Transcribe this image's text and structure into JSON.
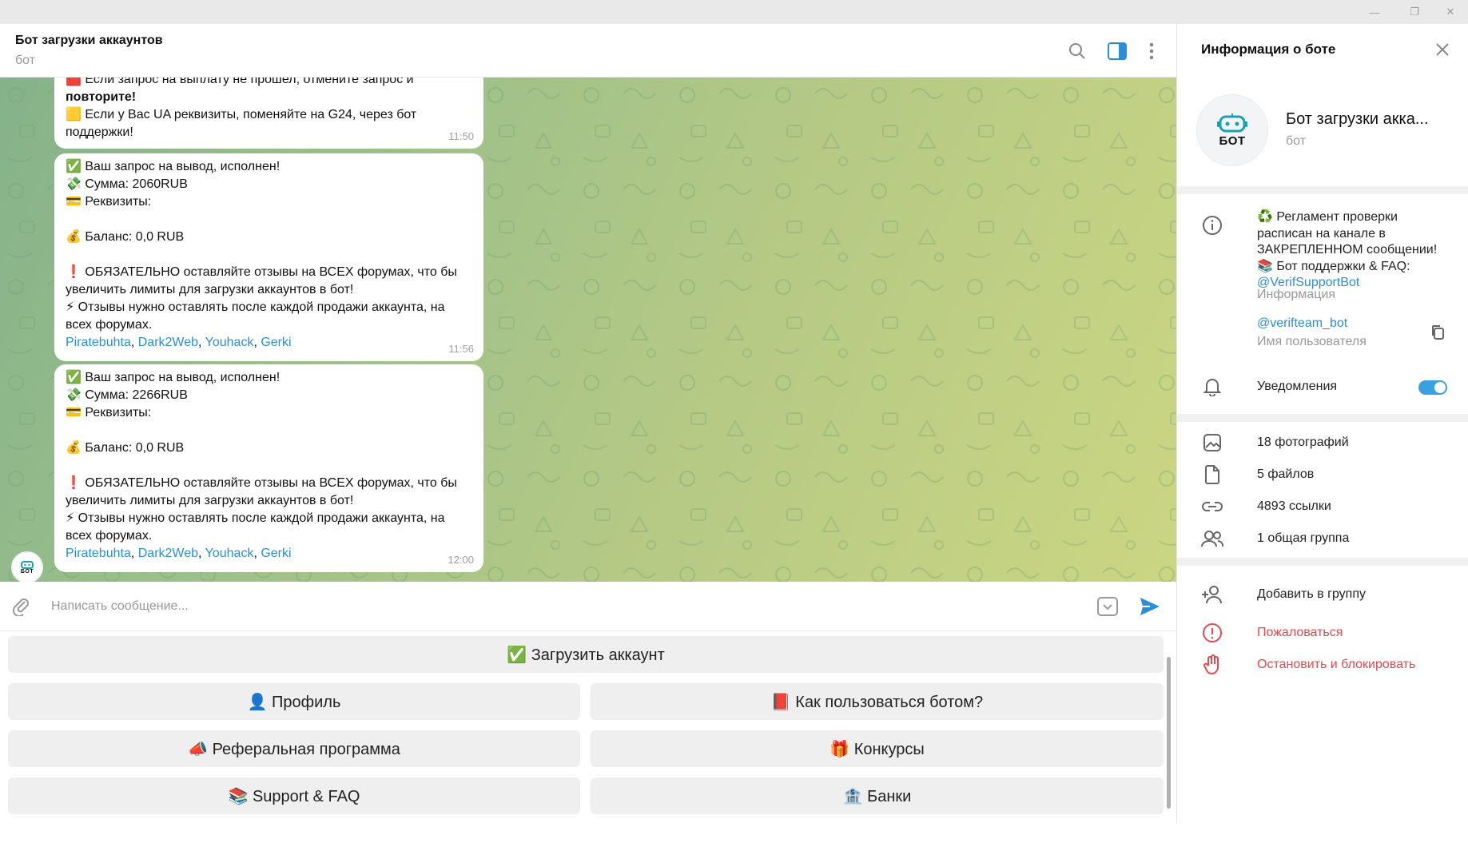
{
  "window": {
    "min": "—",
    "restore": "❐",
    "close": "✕"
  },
  "chat": {
    "title": "Бот загрузки аккаунтов",
    "subtitle": "бот"
  },
  "messages": [
    {
      "lines": [
        "🟥 Если запрос на выплату не прошел, отмените запрос и",
        "повторите!",
        "🟨 Если у Вас UA реквизиты, поменяйте на G24, через бот",
        "поддержки!"
      ],
      "time": "11:50"
    },
    {
      "lines": [
        "✅ Ваш запрос на вывод, исполнен!",
        "💸 Сумма: 2060RUB",
        "💳 Реквизиты: ",
        "",
        "💰 Баланс: 0,0 RUB",
        "",
        "❗ ОБЯЗАТЕЛЬНО оставляйте отзывы на ВСЕХ форумах, что бы",
        "увеличить лимиты для загрузки аккаунтов в бот!",
        "⚡ Отзывы нужно оставлять после каждой продажи аккаунта, на",
        "всех форумах."
      ],
      "links": [
        "Piratebuhta",
        "Dark2Web",
        "Youhack",
        "Gerki"
      ],
      "time": "11:56"
    },
    {
      "lines": [
        "✅ Ваш запрос на вывод, исполнен!",
        "💸 Сумма: 2266RUB",
        "💳 Реквизиты: ",
        "",
        "💰 Баланс: 0,0 RUB",
        "",
        "❗ ОБЯЗАТЕЛЬНО оставляйте отзывы на ВСЕХ форумах, что бы",
        "увеличить лимиты для загрузки аккаунтов в бот!",
        "⚡ Отзывы нужно оставлять после каждой продажи аккаунта, на",
        "всех форумах."
      ],
      "links": [
        "Piratebuhta",
        "Dark2Web",
        "Youhack",
        "Gerki"
      ],
      "time": "12:00"
    }
  ],
  "avatar_text": "БОТ",
  "composer": {
    "placeholder": "Написать сообщение..."
  },
  "keyboard": {
    "upload": "✅ Загрузить аккаунт",
    "profile": "👤 Профиль",
    "howto": "📕 Как пользоваться ботом?",
    "referral": "📣 Реферальная программа",
    "contests": "🎁 Конкурсы",
    "support": "📚 Support & FAQ",
    "banks": "🏦 Банки"
  },
  "side": {
    "header": "Информация о боте",
    "name": "Бот загрузки акка...",
    "type": "бот",
    "info_lines": [
      "♻️ Регламент проверки",
      "расписан на канале в",
      "ЗАКРЕПЛЕННОМ сообщении!",
      "📚 Бот поддержки & FAQ:"
    ],
    "info_link": "@VerifSupportBot",
    "info_label": "Информация",
    "username": "@verifteam_bot",
    "username_label": "Имя пользователя",
    "notifications": "Уведомления",
    "notifications_on": true,
    "photos": "18 фотографий",
    "files": "5 файлов",
    "links": "4893 ссылки",
    "groups": "1 общая группа",
    "add_group": "Добавить в группу",
    "report": "Пожаловаться",
    "block": "Остановить и блокировать"
  },
  "colors": {
    "accent": "#2a8fd6",
    "danger": "#e5484d",
    "toggle": "#3aa0e0",
    "bot_logo": "#1aa0b8"
  }
}
